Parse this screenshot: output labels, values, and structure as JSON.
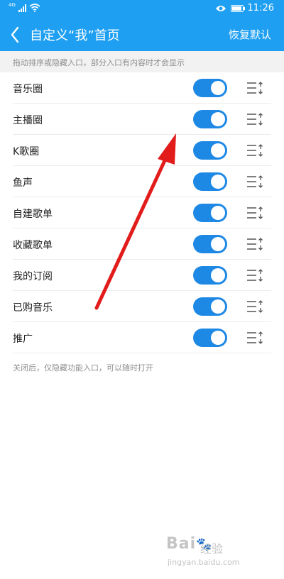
{
  "status_bar": {
    "network_tag": "4G",
    "time": "11:26",
    "battery_level": 0.9
  },
  "header": {
    "title": "自定义“我”首页",
    "restore_label": "恢复默认"
  },
  "hint": "拖动排序或隐藏入口，部分入口有内容时才会显示",
  "items": [
    {
      "label": "音乐圈",
      "enabled": true
    },
    {
      "label": "主播圈",
      "enabled": true
    },
    {
      "label": "K歌圈",
      "enabled": true
    },
    {
      "label": "鱼声",
      "enabled": true
    },
    {
      "label": "自建歌单",
      "enabled": true
    },
    {
      "label": "收藏歌单",
      "enabled": true
    },
    {
      "label": "我的订阅",
      "enabled": true
    },
    {
      "label": "已购音乐",
      "enabled": true
    },
    {
      "label": "推广",
      "enabled": true
    }
  ],
  "footer_note": "关闭后，仅隐藏功能入口，可以随时打开",
  "watermark": {
    "logo": "Bai",
    "logo_suffix": "经验",
    "url": "jingyan.baidu.com"
  },
  "colors": {
    "header_bg": "#1e9ff2",
    "toggle_on": "#1e88e5",
    "annotation_arrow": "#e21b1b"
  },
  "icons": {
    "back": "chevron-left-icon",
    "sort": "drag-sort-icon",
    "eye": "eye-icon",
    "wifi": "wifi-icon",
    "signal": "signal-icon",
    "battery": "battery-icon"
  }
}
